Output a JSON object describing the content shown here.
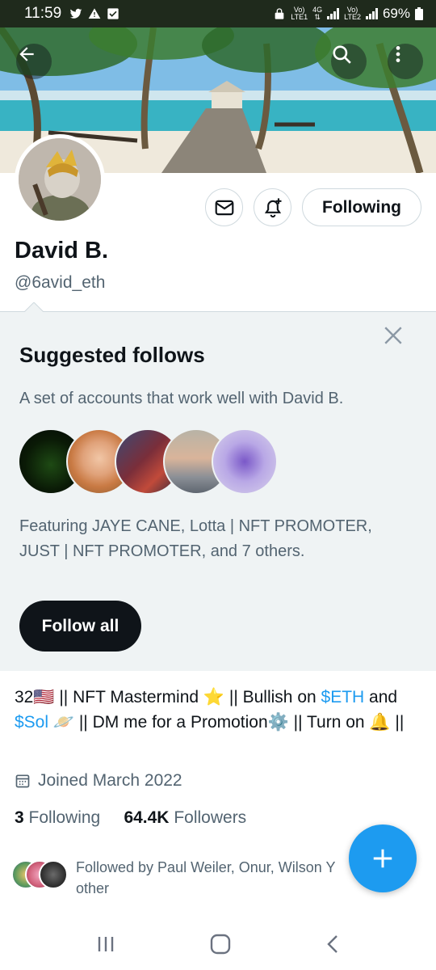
{
  "status_bar": {
    "time": "11:59",
    "battery": "69%",
    "net1_top": "Vo)",
    "net1_bottom": "LTE1",
    "net2_top": "4G",
    "net3_top": "Vo)",
    "net3_bottom": "LTE2"
  },
  "profile": {
    "name": "David B.",
    "handle": "@6avid_eth",
    "following_button": "Following"
  },
  "suggested": {
    "title": "Suggested follows",
    "subtitle": "A set of accounts that work well with David B.",
    "featuring": "Featuring JAYE CANE, Lotta | NFT PROMOTER, JUST | NFT PROMOTER, and 7 others.",
    "follow_all": "Follow all"
  },
  "bio": {
    "part1": "32🇺🇸 || NFT Mastermind ⭐ || Bullish on ",
    "link1": "$ETH",
    "part2": " and ",
    "link2": "$Sol",
    "part3": " 🪐 || DM me for a Promotion⚙️ || Turn on 🔔 ||"
  },
  "joined": "Joined March 2022",
  "counts": {
    "following_count": "3",
    "following_label": "Following",
    "followers_count": "64.4K",
    "followers_label": "Followers"
  },
  "followed_by": "Followed by Paul Weiler, Onur, Wilson Y other",
  "colors": {
    "accent": "#1d9bf0",
    "dark_button": "#0f1419",
    "panel_bg": "#eff3f4",
    "secondary_text": "#536471"
  },
  "icons": {
    "back": "arrow-left-icon",
    "search": "search-icon",
    "more": "more-vertical-icon",
    "message": "envelope-icon",
    "notify": "bell-plus-icon",
    "close": "close-icon",
    "calendar": "calendar-icon",
    "compose": "plus-icon"
  }
}
